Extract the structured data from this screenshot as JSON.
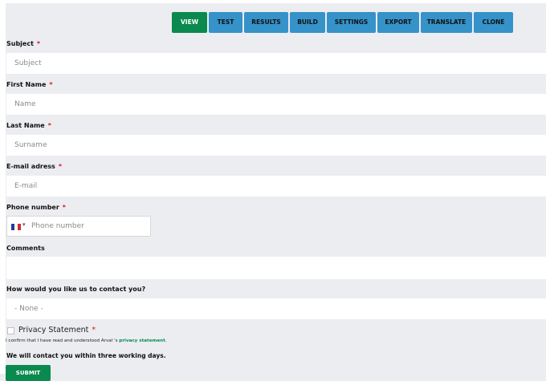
{
  "tabs": [
    {
      "label": "VIEW",
      "active": true
    },
    {
      "label": "TEST"
    },
    {
      "label": "RESULTS"
    },
    {
      "label": "BUILD"
    },
    {
      "label": "SETTINGS"
    },
    {
      "label": "EXPORT"
    },
    {
      "label": "TRANSLATE"
    },
    {
      "label": "CLONE"
    }
  ],
  "form": {
    "required_marker": "*",
    "subject": {
      "label": "Subject",
      "placeholder": "Subject"
    },
    "first_name": {
      "label": "First Name",
      "placeholder": "Name"
    },
    "last_name": {
      "label": "Last Name",
      "placeholder": "Surname"
    },
    "email": {
      "label": "E-mail adress",
      "placeholder": "E-mail"
    },
    "phone": {
      "label": "Phone number",
      "placeholder": "Phone number",
      "country_flag": "france-flag-icon"
    },
    "comments": {
      "label": "Comments",
      "value": ""
    },
    "contact_pref": {
      "label": "How would you like us to contact you?",
      "selected": "- None -"
    },
    "privacy": {
      "title": "Privacy Statement",
      "confirm_prefix": "I confirm that I have read and understood Arval 's",
      "link_text": "privacy statement",
      "confirm_suffix": "."
    },
    "contact_note": "We will contact you within three working days.",
    "submit_label": "SUBMIT"
  },
  "colors": {
    "tab_active": "#0a8a4f",
    "tab": "#3593c9",
    "required": "#d0201a",
    "link": "#0a8a4f"
  }
}
